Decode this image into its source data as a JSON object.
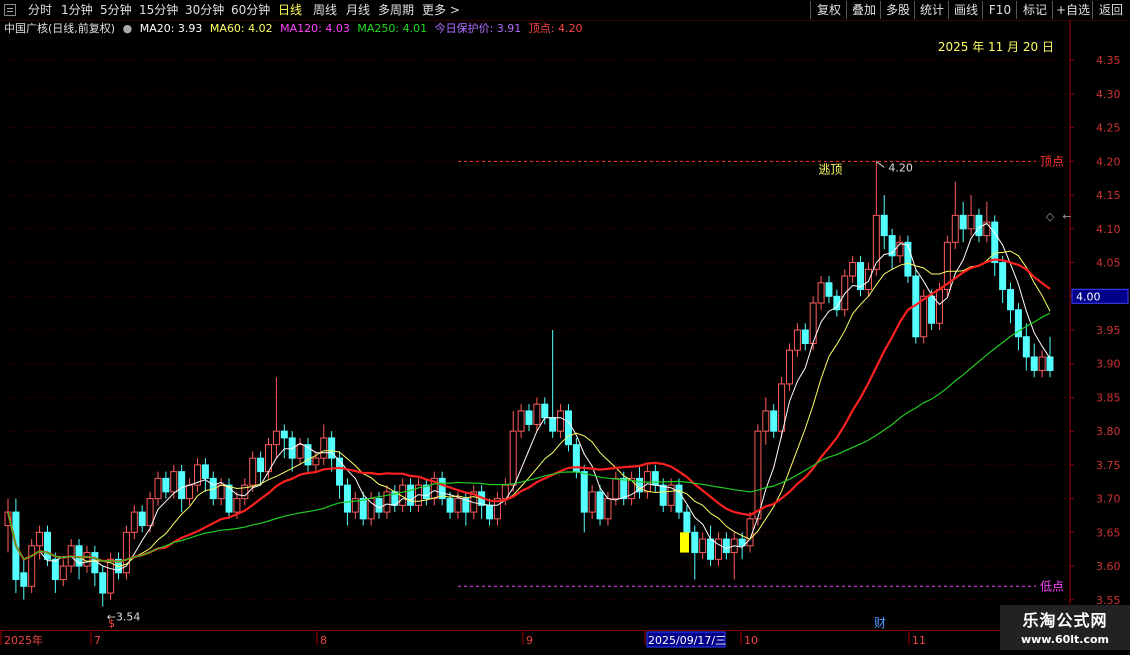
{
  "toolbar": {
    "periods": [
      "分时",
      "1分钟",
      "5分钟",
      "15分钟",
      "30分钟",
      "60分钟",
      "日线",
      "周线",
      "月线",
      "多周期",
      "更多 >"
    ],
    "active_period": "日线",
    "right_buttons": [
      "复权",
      "叠加",
      "多股",
      "统计",
      "画线",
      "F10",
      "标记",
      "+自选",
      "返回"
    ]
  },
  "info": {
    "stock_name": "中国广核(日线,前复权)",
    "ma20": "MA20: 3.93",
    "ma60": "MA60: 4.02",
    "ma120": "MA120: 4.03",
    "ma250": "MA250: 4.01",
    "protect": "今日保护价: 3.91",
    "top": "顶点: 4.20",
    "date": "2025 年 11 月 20 日"
  },
  "colors": {
    "up": "#ff5c5c",
    "down": "#54ffff",
    "ma_white": "#ffffff",
    "ma_yellow": "#ffff66",
    "ma_red": "#ff2020",
    "ma_green": "#22cc22",
    "axis": "#a00000",
    "top_line": "#ff3333",
    "bottom_line": "#ff44ff"
  },
  "chart_data": {
    "type": "candlestick",
    "ylim": [
      3.52,
      4.38
    ],
    "yticks": [
      "4.35",
      "4.30",
      "4.25",
      "4.20",
      "4.15",
      "4.10",
      "4.05",
      "4.00",
      "3.95",
      "3.90",
      "3.85",
      "3.80",
      "3.75",
      "3.70",
      "3.65",
      "3.60",
      "3.55"
    ],
    "current_price": "4.00",
    "annotations": {
      "escape_top": "逃顶",
      "high": "4.20",
      "low": "←3.54",
      "top_label": "顶点",
      "bottom_label": "低点",
      "top_value": 4.2,
      "bottom_value": 3.57
    },
    "x_labels": [
      "2025年",
      "7",
      "8",
      "9",
      "2025/09/17/三",
      "10",
      "11"
    ],
    "markers": [
      "$",
      "财"
    ],
    "candles": [
      [
        3.66,
        3.68,
        3.62,
        3.7
      ],
      [
        3.68,
        3.58,
        3.56,
        3.7
      ],
      [
        3.59,
        3.57,
        3.55,
        3.61
      ],
      [
        3.57,
        3.63,
        3.56,
        3.64
      ],
      [
        3.63,
        3.65,
        3.61,
        3.66
      ],
      [
        3.65,
        3.61,
        3.6,
        3.66
      ],
      [
        3.61,
        3.58,
        3.56,
        3.62
      ],
      [
        3.58,
        3.6,
        3.57,
        3.61
      ],
      [
        3.6,
        3.63,
        3.59,
        3.64
      ],
      [
        3.63,
        3.6,
        3.58,
        3.64
      ],
      [
        3.6,
        3.62,
        3.59,
        3.63
      ],
      [
        3.62,
        3.59,
        3.57,
        3.63
      ],
      [
        3.59,
        3.56,
        3.54,
        3.6
      ],
      [
        3.56,
        3.61,
        3.55,
        3.62
      ],
      [
        3.61,
        3.59,
        3.58,
        3.62
      ],
      [
        3.59,
        3.65,
        3.58,
        3.66
      ],
      [
        3.65,
        3.68,
        3.64,
        3.69
      ],
      [
        3.68,
        3.66,
        3.65,
        3.69
      ],
      [
        3.66,
        3.7,
        3.65,
        3.71
      ],
      [
        3.7,
        3.73,
        3.69,
        3.74
      ],
      [
        3.73,
        3.71,
        3.7,
        3.74
      ],
      [
        3.71,
        3.74,
        3.7,
        3.75
      ],
      [
        3.74,
        3.7,
        3.68,
        3.75
      ],
      [
        3.7,
        3.72,
        3.69,
        3.73
      ],
      [
        3.72,
        3.75,
        3.71,
        3.76
      ],
      [
        3.75,
        3.73,
        3.71,
        3.76
      ],
      [
        3.73,
        3.7,
        3.69,
        3.74
      ],
      [
        3.7,
        3.72,
        3.69,
        3.73
      ],
      [
        3.72,
        3.68,
        3.67,
        3.73
      ],
      [
        3.68,
        3.7,
        3.67,
        3.71
      ],
      [
        3.7,
        3.72,
        3.69,
        3.73
      ],
      [
        3.72,
        3.76,
        3.71,
        3.77
      ],
      [
        3.76,
        3.74,
        3.72,
        3.77
      ],
      [
        3.74,
        3.78,
        3.73,
        3.79
      ],
      [
        3.78,
        3.8,
        3.76,
        3.88
      ],
      [
        3.8,
        3.79,
        3.76,
        3.81
      ],
      [
        3.79,
        3.76,
        3.74,
        3.8
      ],
      [
        3.76,
        3.78,
        3.75,
        3.79
      ],
      [
        3.78,
        3.75,
        3.74,
        3.79
      ],
      [
        3.75,
        3.76,
        3.74,
        3.77
      ],
      [
        3.76,
        3.79,
        3.75,
        3.81
      ],
      [
        3.79,
        3.76,
        3.74,
        3.8
      ],
      [
        3.76,
        3.72,
        3.7,
        3.77
      ],
      [
        3.72,
        3.68,
        3.66,
        3.73
      ],
      [
        3.68,
        3.7,
        3.67,
        3.71
      ],
      [
        3.7,
        3.67,
        3.66,
        3.71
      ],
      [
        3.67,
        3.7,
        3.66,
        3.71
      ],
      [
        3.7,
        3.68,
        3.67,
        3.71
      ],
      [
        3.68,
        3.71,
        3.67,
        3.72
      ],
      [
        3.71,
        3.69,
        3.68,
        3.72
      ],
      [
        3.69,
        3.72,
        3.68,
        3.73
      ],
      [
        3.72,
        3.69,
        3.68,
        3.73
      ],
      [
        3.69,
        3.72,
        3.68,
        3.73
      ],
      [
        3.72,
        3.7,
        3.69,
        3.73
      ],
      [
        3.7,
        3.73,
        3.69,
        3.74
      ],
      [
        3.73,
        3.7,
        3.69,
        3.74
      ],
      [
        3.7,
        3.68,
        3.67,
        3.71
      ],
      [
        3.68,
        3.7,
        3.67,
        3.71
      ],
      [
        3.7,
        3.68,
        3.66,
        3.71
      ],
      [
        3.68,
        3.71,
        3.67,
        3.72
      ],
      [
        3.71,
        3.69,
        3.67,
        3.72
      ],
      [
        3.69,
        3.67,
        3.66,
        3.7
      ],
      [
        3.67,
        3.7,
        3.66,
        3.71
      ],
      [
        3.7,
        3.72,
        3.69,
        3.73
      ],
      [
        3.72,
        3.8,
        3.71,
        3.83
      ],
      [
        3.8,
        3.83,
        3.79,
        3.84
      ],
      [
        3.83,
        3.81,
        3.8,
        3.84
      ],
      [
        3.81,
        3.84,
        3.8,
        3.85
      ],
      [
        3.84,
        3.82,
        3.81,
        3.85
      ],
      [
        3.82,
        3.8,
        3.79,
        3.95
      ],
      [
        3.8,
        3.83,
        3.79,
        3.84
      ],
      [
        3.83,
        3.78,
        3.77,
        3.84
      ],
      [
        3.78,
        3.74,
        3.73,
        3.79
      ],
      [
        3.74,
        3.68,
        3.65,
        3.75
      ],
      [
        3.68,
        3.71,
        3.67,
        3.72
      ],
      [
        3.71,
        3.67,
        3.66,
        3.72
      ],
      [
        3.67,
        3.7,
        3.66,
        3.71
      ],
      [
        3.7,
        3.73,
        3.69,
        3.74
      ],
      [
        3.73,
        3.7,
        3.69,
        3.74
      ],
      [
        3.7,
        3.73,
        3.69,
        3.74
      ],
      [
        3.73,
        3.71,
        3.7,
        3.75
      ],
      [
        3.71,
        3.74,
        3.7,
        3.75
      ],
      [
        3.74,
        3.72,
        3.71,
        3.75
      ],
      [
        3.72,
        3.69,
        3.68,
        3.73
      ],
      [
        3.69,
        3.72,
        3.68,
        3.73
      ],
      [
        3.72,
        3.68,
        3.67,
        3.73
      ],
      [
        3.68,
        3.65,
        3.62,
        3.69
      ],
      [
        3.65,
        3.62,
        3.58,
        3.66
      ],
      [
        3.62,
        3.64,
        3.61,
        3.65
      ],
      [
        3.64,
        3.61,
        3.6,
        3.66
      ],
      [
        3.61,
        3.64,
        3.6,
        3.65
      ],
      [
        3.64,
        3.62,
        3.61,
        3.65
      ],
      [
        3.62,
        3.64,
        3.58,
        3.65
      ],
      [
        3.64,
        3.63,
        3.61,
        3.65
      ],
      [
        3.63,
        3.67,
        3.62,
        3.68
      ],
      [
        3.67,
        3.8,
        3.66,
        3.81
      ],
      [
        3.8,
        3.83,
        3.78,
        3.85
      ],
      [
        3.83,
        3.8,
        3.79,
        3.84
      ],
      [
        3.8,
        3.87,
        3.79,
        3.88
      ],
      [
        3.87,
        3.92,
        3.86,
        3.93
      ],
      [
        3.92,
        3.95,
        3.91,
        3.96
      ],
      [
        3.95,
        3.93,
        3.92,
        3.96
      ],
      [
        3.93,
        3.99,
        3.92,
        4.0
      ],
      [
        3.99,
        4.02,
        3.98,
        4.03
      ],
      [
        4.02,
        4.0,
        3.99,
        4.03
      ],
      [
        4.0,
        3.98,
        3.97,
        4.01
      ],
      [
        3.98,
        4.03,
        3.97,
        4.04
      ],
      [
        4.03,
        4.05,
        4.02,
        4.06
      ],
      [
        4.05,
        4.01,
        4.0,
        4.06
      ],
      [
        4.01,
        4.04,
        4.0,
        4.05
      ],
      [
        4.04,
        4.12,
        4.03,
        4.2
      ],
      [
        4.12,
        4.09,
        4.07,
        4.15
      ],
      [
        4.09,
        4.06,
        4.04,
        4.1
      ],
      [
        4.06,
        4.08,
        4.05,
        4.09
      ],
      [
        4.08,
        4.03,
        4.02,
        4.09
      ],
      [
        4.03,
        3.94,
        3.93,
        4.04
      ],
      [
        3.94,
        4.0,
        3.93,
        4.01
      ],
      [
        4.0,
        3.96,
        3.95,
        4.01
      ],
      [
        3.96,
        4.01,
        3.95,
        4.02
      ],
      [
        4.01,
        4.08,
        4.0,
        4.09
      ],
      [
        4.08,
        4.12,
        4.07,
        4.17
      ],
      [
        4.12,
        4.1,
        4.08,
        4.14
      ],
      [
        4.1,
        4.12,
        4.09,
        4.15
      ],
      [
        4.12,
        4.09,
        4.08,
        4.13
      ],
      [
        4.09,
        4.11,
        4.08,
        4.14
      ],
      [
        4.11,
        4.05,
        4.03,
        4.12
      ],
      [
        4.05,
        4.01,
        3.99,
        4.06
      ],
      [
        4.01,
        3.98,
        3.96,
        4.02
      ],
      [
        3.98,
        3.94,
        3.92,
        3.99
      ],
      [
        3.94,
        3.91,
        3.89,
        3.96
      ],
      [
        3.91,
        3.89,
        3.88,
        3.93
      ],
      [
        3.89,
        3.91,
        3.88,
        3.92
      ],
      [
        3.91,
        3.89,
        3.88,
        3.94
      ]
    ]
  }
}
